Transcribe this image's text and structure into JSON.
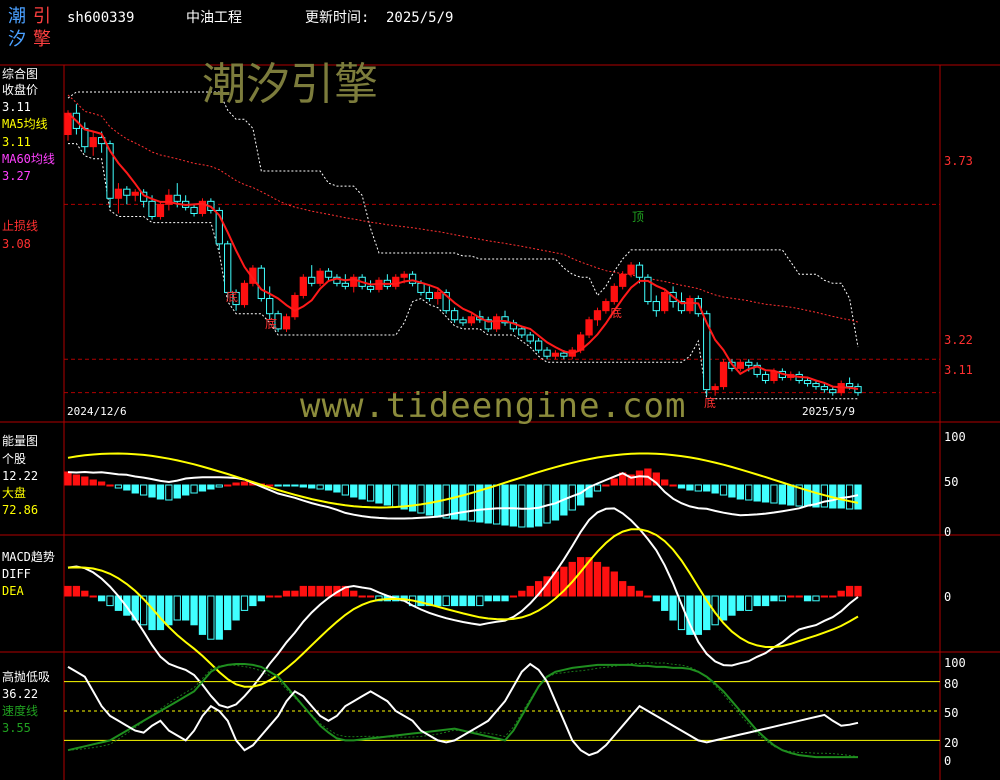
{
  "colors": {
    "background": "#000000",
    "frame": "#b00000",
    "up_candle": "#ff1010",
    "down_candle": "#40ffff",
    "ma5": "#ffffff",
    "ma60": "#ff2020",
    "stop_loss": "#ff2020",
    "label_red": "#ff3030",
    "label_yellow": "#ffff00",
    "label_green": "#20a020",
    "label_cyan": "#40ffff",
    "watermark": "#8c8c3c"
  },
  "header": {
    "logo_chars": [
      "潮",
      "引",
      "汐",
      "擎"
    ],
    "code": "sh600339",
    "name": "中油工程",
    "update_label": "更新时间:",
    "update_date": "2025/5/9"
  },
  "watermark": {
    "title": "潮汐引擎",
    "url": "www.tideengine.com"
  },
  "main_panel": {
    "title": "综合图",
    "close_label": "收盘价",
    "close_value": "3.11",
    "ma5_label": "MA5均线",
    "ma5_value": "3.11",
    "ma60_label": "MA60均线",
    "ma60_value": "3.27",
    "stop_label": "止损线",
    "stop_value": "3.08",
    "right_levels": [
      "3.73",
      "3.22",
      "3.11"
    ],
    "start_date": "2024/12/6",
    "end_date": "2025/5/9",
    "markers": {
      "bottom": "底",
      "top": "顶"
    }
  },
  "energy_panel": {
    "title": "能量图",
    "stock_label": "个股",
    "stock_value": "12.22",
    "market_label": "大盘",
    "market_value": "72.86",
    "scale": [
      "100",
      "50",
      "0"
    ]
  },
  "macd_panel": {
    "title": "MACD趋势",
    "diff_label": "DIFF",
    "dea_label": "DEA",
    "scale": [
      "0"
    ]
  },
  "osc_panel": {
    "title": "高抛低吸",
    "value1": "36.22",
    "speed_label": "速度线",
    "value2": "3.55",
    "scale": [
      "100",
      "80",
      "50",
      "20",
      "0"
    ]
  },
  "chart_data": [
    {
      "type": "candlestick",
      "name": "综合图",
      "y_levels": [
        3.73,
        3.22,
        3.11
      ],
      "x_range": [
        "2024/12/6",
        "2025/5/9"
      ],
      "ohlc": [
        [
          3.96,
          4.04,
          3.94,
          4.03
        ],
        [
          4.03,
          4.06,
          3.96,
          3.98
        ],
        [
          3.98,
          4.0,
          3.9,
          3.92
        ],
        [
          3.92,
          3.97,
          3.89,
          3.95
        ],
        [
          3.95,
          3.97,
          3.9,
          3.93
        ],
        [
          3.93,
          3.94,
          3.72,
          3.75
        ],
        [
          3.75,
          3.8,
          3.7,
          3.78
        ],
        [
          3.78,
          3.79,
          3.73,
          3.76
        ],
        [
          3.76,
          3.78,
          3.74,
          3.77
        ],
        [
          3.77,
          3.78,
          3.72,
          3.74
        ],
        [
          3.74,
          3.76,
          3.68,
          3.69
        ],
        [
          3.69,
          3.74,
          3.68,
          3.73
        ],
        [
          3.73,
          3.78,
          3.71,
          3.76
        ],
        [
          3.76,
          3.8,
          3.72,
          3.74
        ],
        [
          3.74,
          3.76,
          3.71,
          3.72
        ],
        [
          3.72,
          3.73,
          3.69,
          3.7
        ],
        [
          3.7,
          3.75,
          3.69,
          3.74
        ],
        [
          3.74,
          3.75,
          3.7,
          3.71
        ],
        [
          3.71,
          3.72,
          3.58,
          3.6
        ],
        [
          3.6,
          3.61,
          3.42,
          3.44
        ],
        [
          3.44,
          3.45,
          3.38,
          3.4
        ],
        [
          3.4,
          3.48,
          3.39,
          3.47
        ],
        [
          3.47,
          3.53,
          3.46,
          3.52
        ],
        [
          3.52,
          3.53,
          3.41,
          3.42
        ],
        [
          3.42,
          3.46,
          3.35,
          3.37
        ],
        [
          3.37,
          3.38,
          3.31,
          3.32
        ],
        [
          3.32,
          3.37,
          3.31,
          3.36
        ],
        [
          3.36,
          3.44,
          3.35,
          3.43
        ],
        [
          3.43,
          3.5,
          3.42,
          3.49
        ],
        [
          3.49,
          3.53,
          3.46,
          3.47
        ],
        [
          3.47,
          3.52,
          3.46,
          3.51
        ],
        [
          3.51,
          3.52,
          3.48,
          3.49
        ],
        [
          3.49,
          3.5,
          3.46,
          3.47
        ],
        [
          3.47,
          3.5,
          3.45,
          3.46
        ],
        [
          3.46,
          3.5,
          3.44,
          3.49
        ],
        [
          3.49,
          3.5,
          3.45,
          3.46
        ],
        [
          3.46,
          3.48,
          3.44,
          3.45
        ],
        [
          3.45,
          3.49,
          3.44,
          3.48
        ],
        [
          3.48,
          3.5,
          3.45,
          3.46
        ],
        [
          3.46,
          3.5,
          3.45,
          3.49
        ],
        [
          3.49,
          3.51,
          3.47,
          3.5
        ],
        [
          3.5,
          3.51,
          3.46,
          3.47
        ],
        [
          3.47,
          3.48,
          3.43,
          3.44
        ],
        [
          3.44,
          3.46,
          3.41,
          3.42
        ],
        [
          3.42,
          3.45,
          3.4,
          3.44
        ],
        [
          3.44,
          3.45,
          3.37,
          3.38
        ],
        [
          3.38,
          3.39,
          3.34,
          3.35
        ],
        [
          3.35,
          3.36,
          3.33,
          3.34
        ],
        [
          3.34,
          3.37,
          3.33,
          3.36
        ],
        [
          3.36,
          3.38,
          3.34,
          3.35
        ],
        [
          3.35,
          3.36,
          3.31,
          3.32
        ],
        [
          3.32,
          3.37,
          3.31,
          3.36
        ],
        [
          3.36,
          3.38,
          3.33,
          3.34
        ],
        [
          3.34,
          3.35,
          3.31,
          3.32
        ],
        [
          3.32,
          3.33,
          3.29,
          3.3
        ],
        [
          3.3,
          3.31,
          3.27,
          3.28
        ],
        [
          3.28,
          3.29,
          3.24,
          3.25
        ],
        [
          3.25,
          3.26,
          3.22,
          3.23
        ],
        [
          3.23,
          3.25,
          3.22,
          3.24
        ],
        [
          3.24,
          3.25,
          3.22,
          3.23
        ],
        [
          3.23,
          3.26,
          3.22,
          3.25
        ],
        [
          3.25,
          3.31,
          3.24,
          3.3
        ],
        [
          3.3,
          3.36,
          3.29,
          3.35
        ],
        [
          3.35,
          3.39,
          3.33,
          3.38
        ],
        [
          3.38,
          3.42,
          3.37,
          3.41
        ],
        [
          3.41,
          3.47,
          3.4,
          3.46
        ],
        [
          3.46,
          3.51,
          3.45,
          3.5
        ],
        [
          3.5,
          3.54,
          3.49,
          3.53
        ],
        [
          3.53,
          3.54,
          3.47,
          3.49
        ],
        [
          3.49,
          3.5,
          3.4,
          3.41
        ],
        [
          3.41,
          3.43,
          3.36,
          3.38
        ],
        [
          3.38,
          3.45,
          3.37,
          3.44
        ],
        [
          3.44,
          3.46,
          3.39,
          3.41
        ],
        [
          3.41,
          3.44,
          3.37,
          3.38
        ],
        [
          3.38,
          3.43,
          3.37,
          3.42
        ],
        [
          3.42,
          3.43,
          3.36,
          3.37
        ],
        [
          3.37,
          3.38,
          3.1,
          3.12
        ],
        [
          3.12,
          3.14,
          3.1,
          3.13
        ],
        [
          3.13,
          3.22,
          3.12,
          3.21
        ],
        [
          3.21,
          3.22,
          3.18,
          3.19
        ],
        [
          3.19,
          3.22,
          3.18,
          3.21
        ],
        [
          3.21,
          3.22,
          3.18,
          3.2
        ],
        [
          3.2,
          3.21,
          3.16,
          3.17
        ],
        [
          3.17,
          3.18,
          3.14,
          3.15
        ],
        [
          3.15,
          3.19,
          3.14,
          3.18
        ],
        [
          3.18,
          3.19,
          3.15,
          3.16
        ],
        [
          3.16,
          3.18,
          3.15,
          3.17
        ],
        [
          3.17,
          3.18,
          3.14,
          3.15
        ],
        [
          3.15,
          3.16,
          3.13,
          3.14
        ],
        [
          3.14,
          3.15,
          3.12,
          3.13
        ],
        [
          3.13,
          3.14,
          3.11,
          3.12
        ],
        [
          3.12,
          3.13,
          3.1,
          3.11
        ],
        [
          3.11,
          3.15,
          3.1,
          3.14
        ],
        [
          3.14,
          3.16,
          3.12,
          3.13
        ],
        [
          3.13,
          3.14,
          3.1,
          3.11
        ]
      ]
    },
    {
      "type": "bar",
      "name": "能量图",
      "y_scale": [
        0,
        100
      ],
      "values": [
        13,
        10,
        8,
        5,
        3,
        0,
        -3,
        -5,
        -8,
        -10,
        -12,
        -14,
        -15,
        -13,
        -10,
        -8,
        -6,
        -4,
        -2,
        0,
        2,
        3,
        2,
        1,
        0,
        -1,
        -1,
        -1,
        -2,
        -3,
        -4,
        -5,
        -7,
        -10,
        -12,
        -14,
        -16,
        -18,
        -20,
        -22,
        -24,
        -26,
        -28,
        -30,
        -32,
        -33,
        -34,
        -35,
        -36,
        -37,
        -38,
        -39,
        -40,
        -41,
        -42,
        -42,
        -41,
        -38,
        -35,
        -30,
        -25,
        -20,
        -12,
        -6,
        0,
        6,
        12,
        10,
        14,
        16,
        12,
        5,
        0,
        -3,
        -5,
        -6,
        -6,
        -8,
        -10,
        -12,
        -14,
        -15,
        -16,
        -17,
        -18,
        -19,
        -20,
        -21,
        -21,
        -22,
        -22,
        -23,
        -23,
        -24,
        -24
      ]
    },
    {
      "type": "bar",
      "name": "MACD趋势",
      "values": [
        0.02,
        0.02,
        0.01,
        0.0,
        -0.01,
        -0.02,
        -0.03,
        -0.04,
        -0.05,
        -0.06,
        -0.07,
        -0.07,
        -0.06,
        -0.05,
        -0.05,
        -0.06,
        -0.08,
        -0.09,
        -0.09,
        -0.07,
        -0.05,
        -0.03,
        -0.02,
        -0.01,
        0.0,
        0.0,
        0.01,
        0.01,
        0.02,
        0.02,
        0.02,
        0.02,
        0.02,
        0.02,
        0.01,
        0.0,
        0.0,
        -0.01,
        -0.01,
        -0.01,
        -0.01,
        -0.02,
        -0.02,
        -0.02,
        -0.02,
        -0.02,
        -0.02,
        -0.02,
        -0.02,
        -0.02,
        -0.01,
        -0.01,
        -0.01,
        0.0,
        0.01,
        0.02,
        0.03,
        0.04,
        0.05,
        0.06,
        0.07,
        0.08,
        0.08,
        0.07,
        0.06,
        0.05,
        0.03,
        0.02,
        0.01,
        0.0,
        -0.01,
        -0.03,
        -0.05,
        -0.07,
        -0.08,
        -0.08,
        -0.07,
        -0.06,
        -0.05,
        -0.04,
        -0.03,
        -0.03,
        -0.02,
        -0.02,
        -0.01,
        -0.01,
        0.0,
        0.0,
        -0.01,
        -0.01,
        0.0,
        0.0,
        0.01,
        0.02,
        0.02
      ]
    },
    {
      "type": "line",
      "name": "高抛低吸",
      "y_scale": [
        0,
        100
      ],
      "reference_lines": [
        80,
        50,
        20
      ],
      "series": [
        {
          "name": "高抛低吸",
          "values": [
            95,
            90,
            85,
            70,
            55,
            45,
            40,
            35,
            30,
            28,
            35,
            40,
            30,
            25,
            20,
            30,
            45,
            55,
            50,
            40,
            20,
            10,
            15,
            25,
            35,
            45,
            60,
            70,
            65,
            55,
            45,
            40,
            45,
            55,
            60,
            65,
            70,
            65,
            60,
            50,
            45,
            40,
            30,
            25,
            20,
            18,
            20,
            25,
            30,
            35,
            40,
            50,
            60,
            75,
            90,
            98,
            92,
            80,
            60,
            40,
            20,
            10,
            5,
            8,
            15,
            25,
            35,
            45,
            55,
            50,
            45,
            40,
            35,
            30,
            25,
            20,
            18,
            20,
            22,
            24,
            26,
            28,
            30,
            32,
            34,
            36,
            38,
            40,
            42,
            44,
            46,
            40,
            35,
            36,
            38
          ]
        },
        {
          "name": "速度线",
          "values": [
            10,
            12,
            14,
            16,
            18,
            20,
            25,
            30,
            35,
            40,
            45,
            50,
            55,
            60,
            65,
            70,
            80,
            90,
            95,
            97,
            98,
            98,
            97,
            95,
            90,
            85,
            75,
            65,
            55,
            45,
            35,
            28,
            22,
            20,
            20,
            21,
            22,
            23,
            24,
            25,
            26,
            27,
            28,
            29,
            30,
            31,
            32,
            30,
            28,
            26,
            24,
            22,
            20,
            30,
            45,
            60,
            75,
            85,
            90,
            92,
            94,
            95,
            96,
            97,
            97,
            97,
            97,
            97,
            96,
            96,
            95,
            95,
            94,
            94,
            93,
            90,
            85,
            78,
            70,
            60,
            50,
            40,
            30,
            22,
            15,
            10,
            7,
            5,
            4,
            3,
            3,
            3,
            3,
            3,
            3
          ]
        }
      ]
    }
  ]
}
